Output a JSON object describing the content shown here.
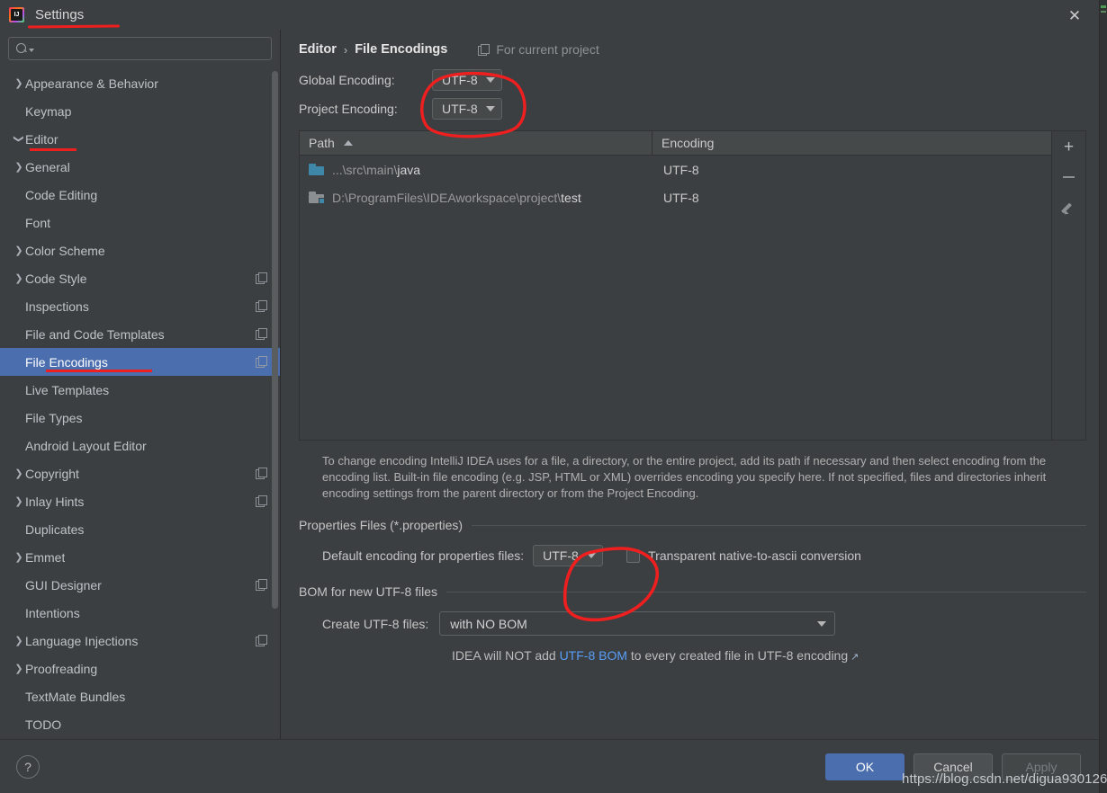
{
  "window": {
    "title": "Settings",
    "app_icon": "intellij-idea-icon",
    "close_icon": "close-icon"
  },
  "search": {
    "value": "",
    "placeholder": "",
    "icon": "search-icon"
  },
  "sidebar": {
    "items": [
      {
        "label": "Appearance & Behavior",
        "depth": 0,
        "arrow": "collapsed",
        "copy": false,
        "selected": false
      },
      {
        "label": "Keymap",
        "depth": 1,
        "arrow": "none",
        "copy": false,
        "selected": false
      },
      {
        "label": "Editor",
        "depth": 0,
        "arrow": "expanded",
        "copy": false,
        "selected": false
      },
      {
        "label": "General",
        "depth": 1,
        "arrow": "collapsed",
        "copy": false,
        "selected": false
      },
      {
        "label": "Code Editing",
        "depth": 1,
        "arrow": "none",
        "copy": false,
        "selected": false
      },
      {
        "label": "Font",
        "depth": 1,
        "arrow": "none",
        "copy": false,
        "selected": false
      },
      {
        "label": "Color Scheme",
        "depth": 1,
        "arrow": "collapsed",
        "copy": false,
        "selected": false
      },
      {
        "label": "Code Style",
        "depth": 1,
        "arrow": "collapsed",
        "copy": true,
        "selected": false
      },
      {
        "label": "Inspections",
        "depth": 1,
        "arrow": "none",
        "copy": true,
        "selected": false
      },
      {
        "label": "File and Code Templates",
        "depth": 1,
        "arrow": "none",
        "copy": true,
        "selected": false
      },
      {
        "label": "File Encodings",
        "depth": 1,
        "arrow": "none",
        "copy": true,
        "selected": true
      },
      {
        "label": "Live Templates",
        "depth": 1,
        "arrow": "none",
        "copy": false,
        "selected": false
      },
      {
        "label": "File Types",
        "depth": 1,
        "arrow": "none",
        "copy": false,
        "selected": false
      },
      {
        "label": "Android Layout Editor",
        "depth": 1,
        "arrow": "none",
        "copy": false,
        "selected": false
      },
      {
        "label": "Copyright",
        "depth": 1,
        "arrow": "collapsed",
        "copy": true,
        "selected": false
      },
      {
        "label": "Inlay Hints",
        "depth": 1,
        "arrow": "collapsed",
        "copy": true,
        "selected": false
      },
      {
        "label": "Duplicates",
        "depth": 1,
        "arrow": "none",
        "copy": false,
        "selected": false
      },
      {
        "label": "Emmet",
        "depth": 1,
        "arrow": "collapsed",
        "copy": false,
        "selected": false
      },
      {
        "label": "GUI Designer",
        "depth": 1,
        "arrow": "none",
        "copy": true,
        "selected": false
      },
      {
        "label": "Intentions",
        "depth": 1,
        "arrow": "none",
        "copy": false,
        "selected": false
      },
      {
        "label": "Language Injections",
        "depth": 1,
        "arrow": "collapsed",
        "copy": true,
        "selected": false
      },
      {
        "label": "Proofreading",
        "depth": 1,
        "arrow": "collapsed",
        "copy": false,
        "selected": false
      },
      {
        "label": "TextMate Bundles",
        "depth": 1,
        "arrow": "none",
        "copy": false,
        "selected": false
      },
      {
        "label": "TODO",
        "depth": 1,
        "arrow": "none",
        "copy": false,
        "selected": false
      }
    ]
  },
  "breadcrumb": {
    "parent": "Editor",
    "separator": "›",
    "current": "File Encodings",
    "scope_label": "For current project",
    "scope_icon": "copy-icon"
  },
  "encodings": {
    "global_label": "Global Encoding:",
    "global_value": "UTF-8",
    "project_label": "Project Encoding:",
    "project_value": "UTF-8"
  },
  "table": {
    "columns": [
      "Path",
      "Encoding"
    ],
    "sort_column": "Path",
    "sort_direction": "asc",
    "rows": [
      {
        "icon": "folder-icon",
        "path_dim": "...\\src\\main\\",
        "path_lit": "java",
        "encoding": "UTF-8"
      },
      {
        "icon": "module-folder-icon",
        "path_dim": "D:\\ProgramFiles\\IDEAworkspace\\project\\",
        "path_lit": "test",
        "encoding": "UTF-8"
      }
    ],
    "toolbar": {
      "add": "+",
      "add_icon": "plus-icon",
      "remove_icon": "minus-icon",
      "edit_icon": "pencil-icon"
    }
  },
  "help_text": "To change encoding IntelliJ IDEA uses for a file, a directory, or the entire project, add its path if necessary and then select encoding from the encoding list. Built-in file encoding (e.g. JSP, HTML or XML) overrides encoding you specify here. If not specified, files and directories inherit encoding settings from the parent directory or from the Project Encoding.",
  "properties_section": {
    "title": "Properties Files (*.properties)",
    "default_encoding_label": "Default encoding for properties files:",
    "default_encoding_value": "UTF-8",
    "transparent_label": "Transparent native-to-ascii conversion",
    "transparent_checked": false
  },
  "bom_section": {
    "title": "BOM for new UTF-8 files",
    "create_label": "Create UTF-8 files:",
    "create_value": "with NO BOM",
    "note_prefix": "IDEA will NOT add ",
    "note_link": "UTF-8 BOM",
    "note_suffix": " to every created file in UTF-8 encoding",
    "external_link_icon": "external-link-icon"
  },
  "footer": {
    "help_icon": "question-mark-icon",
    "ok": "OK",
    "cancel": "Cancel",
    "apply": "Apply",
    "apply_disabled": true
  },
  "watermark": "https://blog.csdn.net/digua930126",
  "annotations": {
    "accent_color": "#ef1f1f",
    "marks": [
      "underline-settings-title",
      "underline-editor-item",
      "underline-file-encodings-item",
      "circle-global-project-encoding",
      "circle-properties-default-encoding"
    ]
  },
  "colors": {
    "panel_bg": "#3c3f41",
    "selection_blue": "#4b6eaf",
    "link_blue": "#589df6",
    "annotation_red": "#ef1f1f",
    "folder_blue": "#3e87a8"
  }
}
